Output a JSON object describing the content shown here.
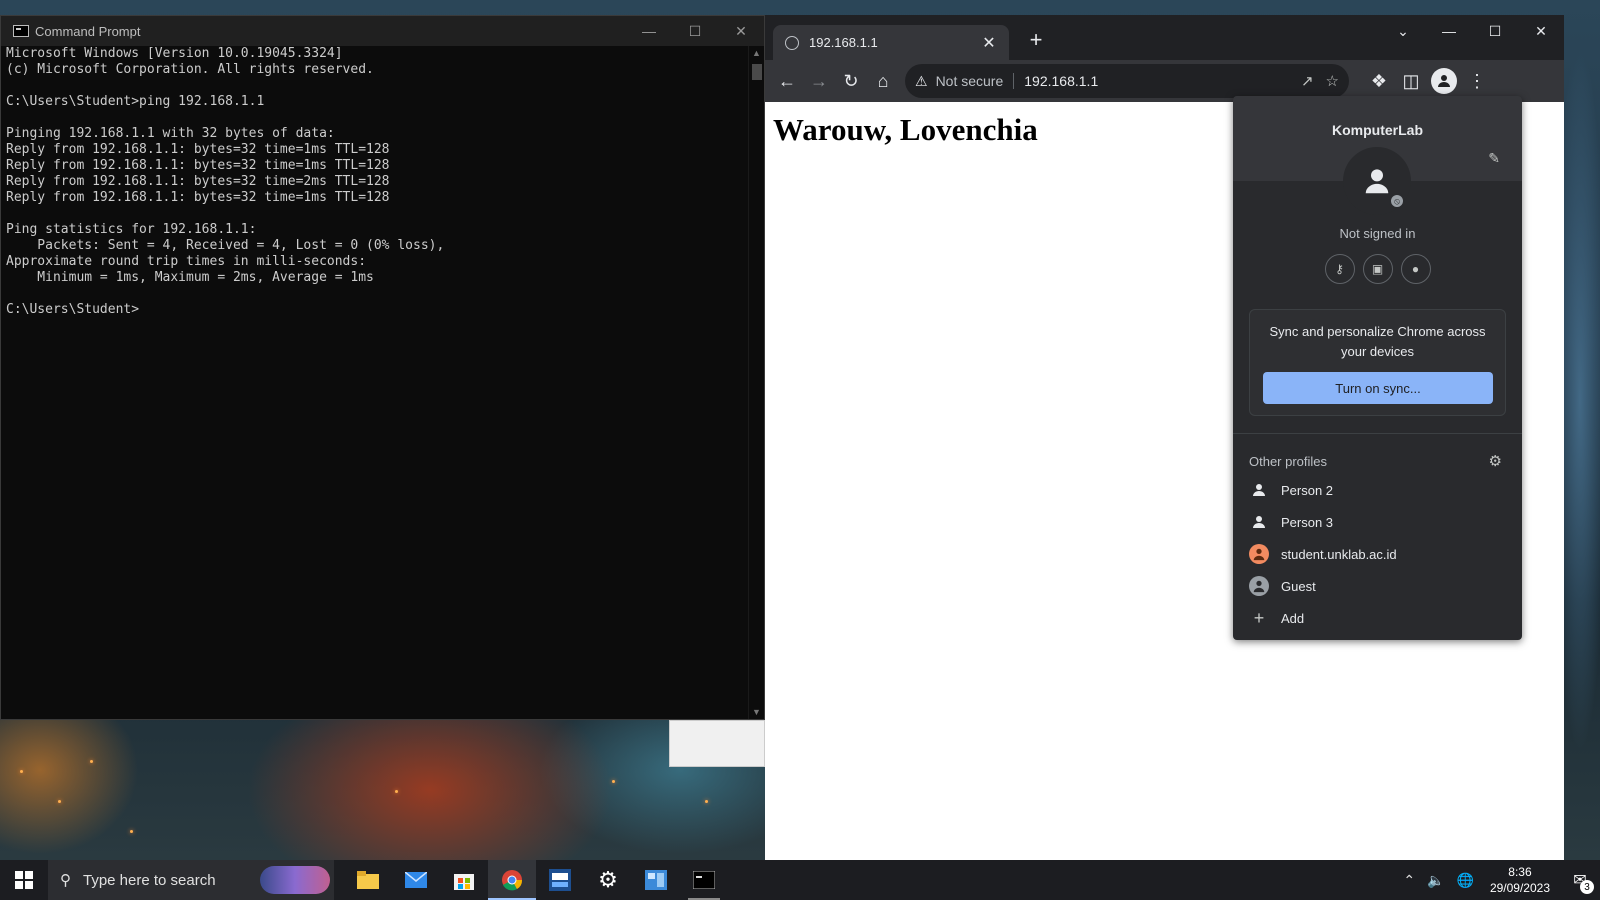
{
  "cmd": {
    "title": "Command Prompt",
    "lines": [
      "Microsoft Windows [Version 10.0.19045.3324]",
      "(c) Microsoft Corporation. All rights reserved.",
      "",
      "C:\\Users\\Student>ping 192.168.1.1",
      "",
      "Pinging 192.168.1.1 with 32 bytes of data:",
      "Reply from 192.168.1.1: bytes=32 time=1ms TTL=128",
      "Reply from 192.168.1.1: bytes=32 time=1ms TTL=128",
      "Reply from 192.168.1.1: bytes=32 time=2ms TTL=128",
      "Reply from 192.168.1.1: bytes=32 time=1ms TTL=128",
      "",
      "Ping statistics for 192.168.1.1:",
      "    Packets: Sent = 4, Received = 4, Lost = 0 (0% loss),",
      "Approximate round trip times in milli-seconds:",
      "    Minimum = 1ms, Maximum = 2ms, Average = 1ms",
      "",
      "C:\\Users\\Student>"
    ]
  },
  "browser": {
    "tab_title": "192.168.1.1",
    "security_label": "Not secure",
    "url": "192.168.1.1",
    "page_heading": "Warouw, Lovenchia"
  },
  "profile_menu": {
    "profile_name": "KomputerLab",
    "status": "Not signed in",
    "sync_text": "Sync and personalize Chrome across your devices",
    "sync_button": "Turn on sync...",
    "other_profiles_label": "Other profiles",
    "profiles": [
      {
        "label": "Person 2",
        "icon": "person-icon"
      },
      {
        "label": "Person 3",
        "icon": "person-icon"
      },
      {
        "label": "student.unklab.ac.id",
        "icon": "orange-avatar-icon"
      },
      {
        "label": "Guest",
        "icon": "guest-icon"
      },
      {
        "label": "Add",
        "icon": "plus-icon"
      }
    ]
  },
  "taskbar": {
    "search_placeholder": "Type here to search",
    "time": "8:36",
    "date": "29/09/2023",
    "notification_count": "3"
  },
  "colors": {
    "sync_button": "#8ab4f8",
    "chrome_dark": "#35363a",
    "cmd_bg": "#0c0c0c"
  }
}
